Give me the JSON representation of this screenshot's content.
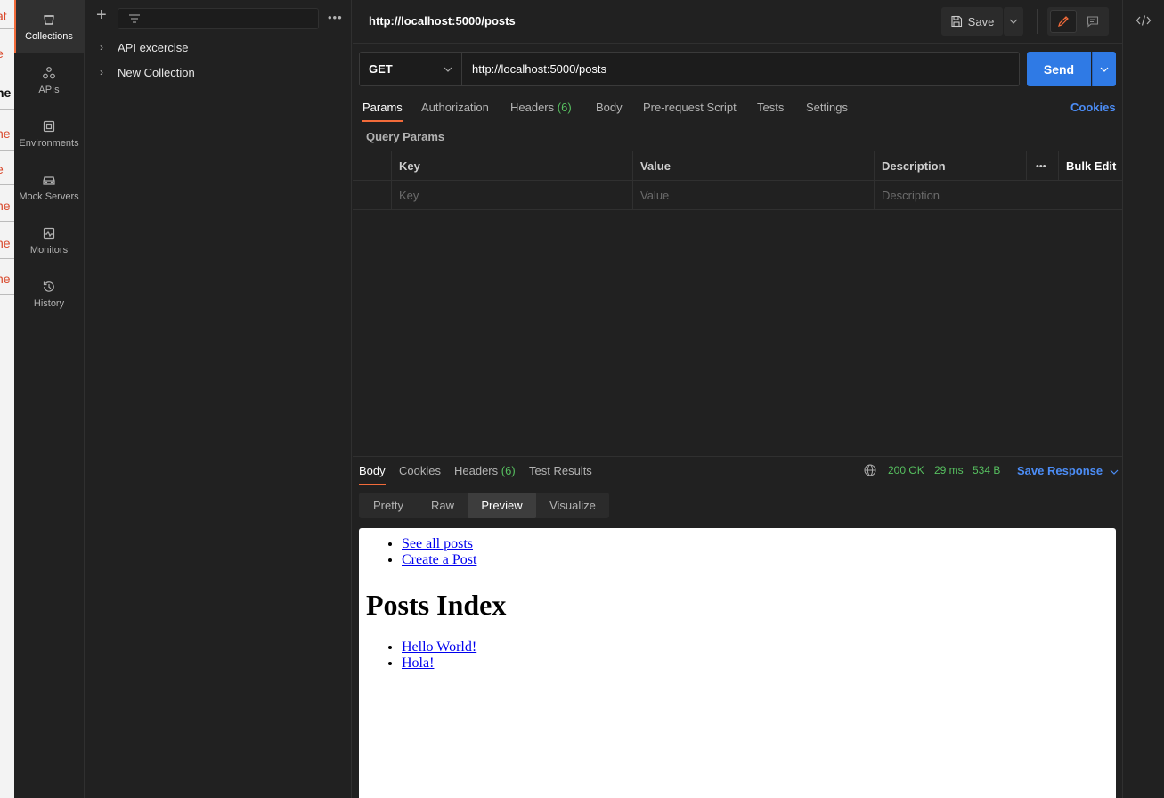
{
  "background_window": {
    "fragments": [
      "at",
      "e",
      "he",
      "he",
      "e",
      "he",
      "he",
      "he"
    ]
  },
  "rail": {
    "items": [
      {
        "label": "Collections",
        "icon": "collections-icon",
        "active": true
      },
      {
        "label": "APIs",
        "icon": "apis-icon"
      },
      {
        "label": "Environments",
        "icon": "environments-icon"
      },
      {
        "label": "Mock Servers",
        "icon": "mock-servers-icon"
      },
      {
        "label": "Monitors",
        "icon": "monitors-icon"
      },
      {
        "label": "History",
        "icon": "history-icon"
      }
    ]
  },
  "sidebar": {
    "collections": [
      {
        "label": "API excercise"
      },
      {
        "label": "New Collection"
      }
    ]
  },
  "request": {
    "title": "http://localhost:5000/posts",
    "save_label": "Save",
    "method": "GET",
    "url": "http://localhost:5000/posts",
    "send_label": "Send"
  },
  "request_tabs": {
    "params": "Params",
    "authorization": "Authorization",
    "headers": "Headers",
    "headers_count": "(6)",
    "body": "Body",
    "prerequest": "Pre-request Script",
    "tests": "Tests",
    "settings": "Settings",
    "cookies": "Cookies"
  },
  "params": {
    "section_label": "Query Params",
    "columns": {
      "key": "Key",
      "value": "Value",
      "description": "Description",
      "more": "•••",
      "bulk_edit": "Bulk Edit"
    },
    "placeholders": {
      "key": "Key",
      "value": "Value",
      "description": "Description"
    }
  },
  "response": {
    "tabs": {
      "body": "Body",
      "cookies": "Cookies",
      "headers": "Headers",
      "headers_count": "(6)",
      "test_results": "Test Results"
    },
    "status": "200 OK",
    "time": "29 ms",
    "size": "534 B",
    "save_response": "Save Response",
    "view_tabs": {
      "pretty": "Pretty",
      "raw": "Raw",
      "preview": "Preview",
      "visualize": "Visualize"
    },
    "preview": {
      "nav_links": [
        "See all posts",
        "Create a Post"
      ],
      "heading": "Posts Index",
      "posts": [
        "Hello World!",
        "Hola!"
      ]
    }
  },
  "colors": {
    "accent": "#f26b3a",
    "primary": "#2f7ae5",
    "success": "#56bf5f",
    "link": "#4c8df6"
  }
}
